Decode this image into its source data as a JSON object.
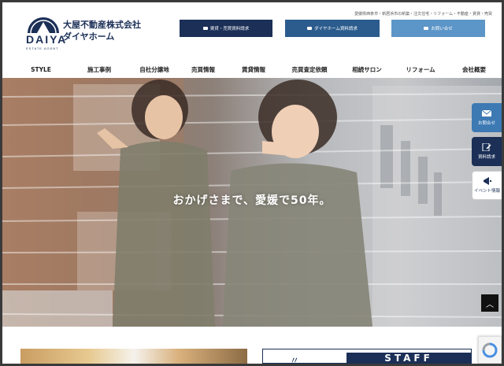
{
  "header": {
    "company_name": "大屋不動産株式会社",
    "brand_name": "ダイヤホーム",
    "logo_text": "DAIYA",
    "logo_subtext": "ESTATE AGENT",
    "tagline": "愛媛県西条市・新居浜市の新築・注文住宅・リフォーム・不動産・賃貸・売買",
    "buttons": [
      {
        "label": "賃貸・売買資料請求",
        "icon": "mail-icon"
      },
      {
        "label": "ダイヤホーム資料請求",
        "icon": "mail-icon"
      },
      {
        "label": "お問い合せ",
        "icon": "mail-icon"
      }
    ],
    "colors": {
      "navy": "#1b2f57",
      "blue": "#2c5c8e",
      "light_blue": "#5c95c7"
    }
  },
  "nav": {
    "items": [
      "STYLE",
      "施工事例",
      "自社分譲地",
      "売買情報",
      "賃貸情報",
      "売買査定依頼",
      "相続サロン",
      "リフォーム",
      "会社概要"
    ]
  },
  "hero": {
    "caption": "おかげさまで、愛媛で50年。"
  },
  "side_tabs": [
    {
      "label": "お問合せ",
      "icon": "mail-icon"
    },
    {
      "label": "資料請求",
      "icon": "document-edit-icon"
    },
    {
      "label": "イベント情報",
      "icon": "megaphone-icon"
    }
  ],
  "back_to_top": {
    "icon": "chevron-up-icon"
  },
  "bottom": {
    "staff_label": "STAFF",
    "staff_deco": "〃"
  }
}
